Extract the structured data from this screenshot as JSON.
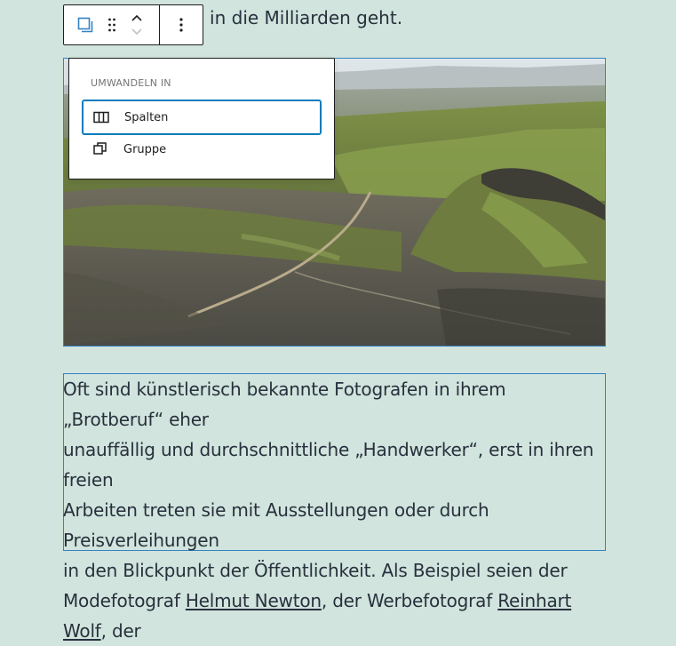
{
  "top_text": "h in die Milliarden geht.",
  "toolbar": {
    "block_type_icon": "group-icon",
    "drag_icon": "drag-handle-icon",
    "move_up_icon": "chevron-up-icon",
    "move_down_icon": "chevron-down-icon",
    "more_icon": "more-vertical-icon"
  },
  "transform_menu": {
    "title": "Umwandeln in",
    "items": [
      {
        "label": "Spalten",
        "icon": "columns-icon",
        "focused": true
      },
      {
        "label": "Gruppe",
        "icon": "group-icon",
        "focused": false
      }
    ]
  },
  "paragraph": {
    "line1": "Oft sind künstlerisch bekannte Fotografen in ihrem „Brotberuf“ eher",
    "line2": "unauffällig und durchschnittliche „Handwerker“, erst in ihren freien",
    "line3": "Arbeiten treten sie mit Ausstellungen oder durch Preisverleihungen",
    "line4": "in den Blickpunkt der Öffentlichkeit. Als Beispiel seien der",
    "line5_pre": "Modefotograf ",
    "link1": "Helmut Newton",
    "line5_mid": ", der Werbefotograf ",
    "link2": "Reinhart Wolf",
    "line5_post": ", der"
  },
  "colors": {
    "background": "#d1e4dd",
    "text": "#28303d",
    "block_outline": "#3582c4",
    "focus": "#007cba",
    "icon_accent": "#3582c4"
  }
}
